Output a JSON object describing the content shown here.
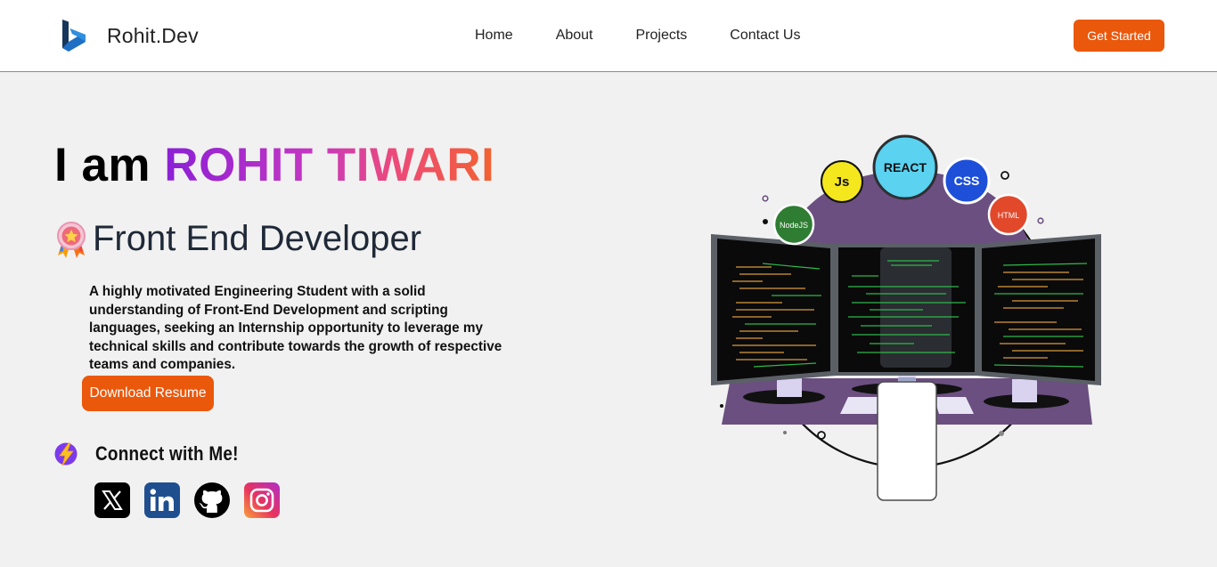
{
  "navbar": {
    "brand": "Rohit.Dev",
    "logo_icon": "bing-style-b-logo",
    "links": [
      "Home",
      "About",
      "Projects",
      "Contact Us"
    ],
    "cta": "Get Started"
  },
  "hero": {
    "greeting": "I am",
    "name": "ROHIT TIWARI",
    "role_icon": "award-medal-icon",
    "role": "Front End Developer",
    "bio": "A highly motivated Engineering Student with a solid understanding of Front-End Development and scripting languages, seeking an Internship opportunity to leverage my technical skills and contribute towards the growth of respective teams and companies.",
    "download_label": "Download Resume"
  },
  "connect": {
    "icon": "lightning-icon",
    "title": "Connect with Me!",
    "socials": [
      "x-twitter-icon",
      "linkedin-icon",
      "github-icon",
      "instagram-icon"
    ]
  },
  "illustration": {
    "badges": [
      "REACT",
      "Js",
      "CSS",
      "NodeJS",
      "HTML"
    ]
  },
  "colors": {
    "accent": "#ea580c",
    "name_gradient": [
      "#8b1fd6",
      "#c537c2",
      "#ec4a7a",
      "#f2622f"
    ],
    "desk": "#6b4f80"
  }
}
